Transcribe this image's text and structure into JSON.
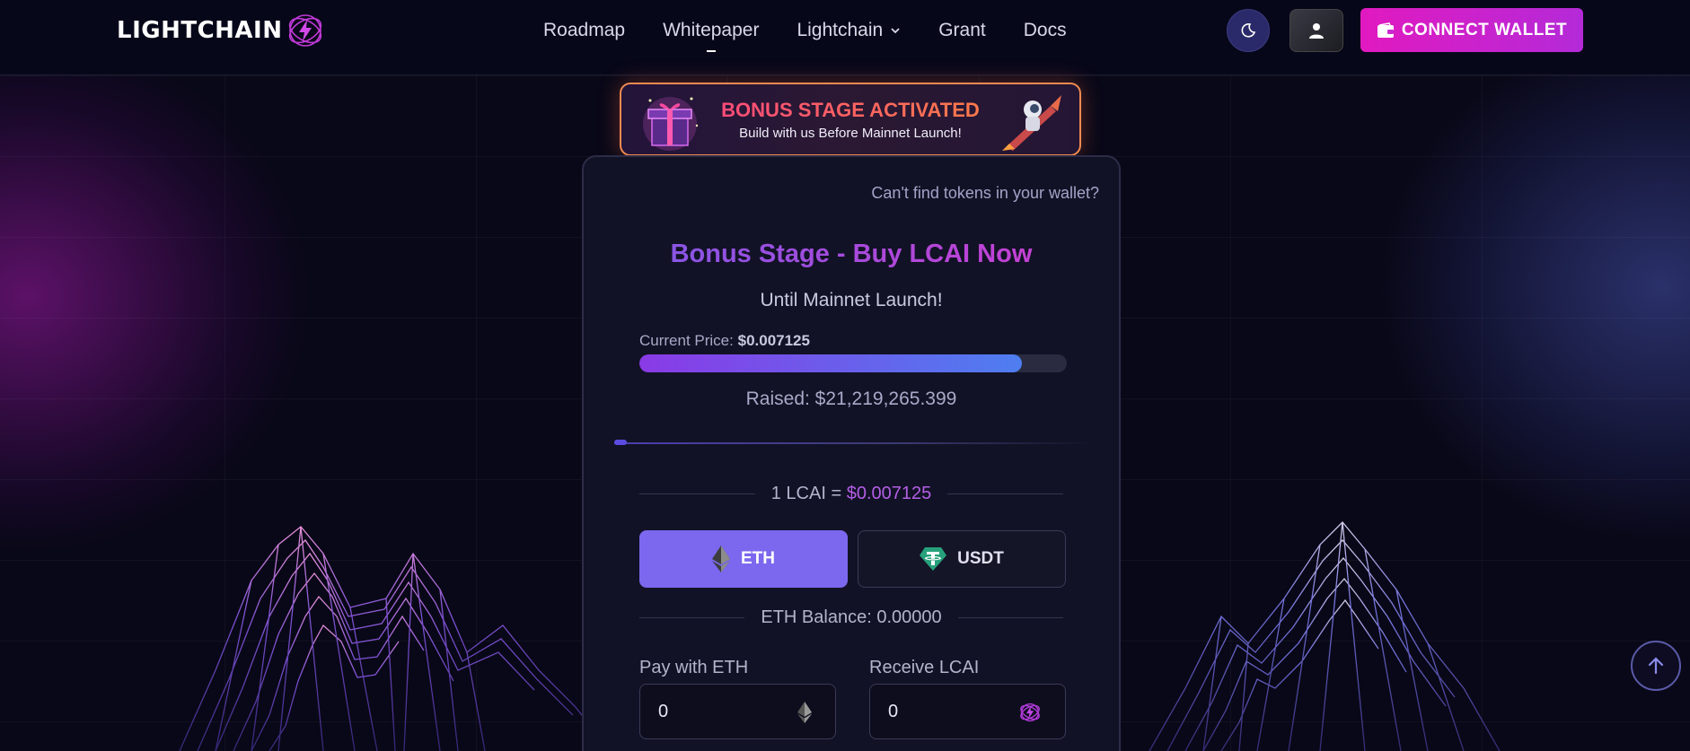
{
  "header": {
    "logo_text": "LIGHTCHAIN",
    "nav": [
      {
        "label": "Roadmap"
      },
      {
        "label": "Whitepaper"
      },
      {
        "label": "Lightchain"
      },
      {
        "label": "Grant"
      },
      {
        "label": "Docs"
      }
    ],
    "connect_wallet_label": "CONNECT WALLET"
  },
  "banner": {
    "title": "BONUS STAGE ACTIVATED",
    "subtitle": "Build with us Before Mainnet Launch!"
  },
  "card": {
    "help_link": "Can't find tokens in your wallet?",
    "title": "Bonus Stage - Buy LCAI Now",
    "subtitle": "Until Mainnet Launch!",
    "price_label": "Current Price:",
    "price_value": "$0.007125",
    "progress_fraction": 0.894,
    "raised": "Raised: $21,219,265.399",
    "rate_label": "1 LCAI =",
    "rate_value": "$0.007125",
    "tokens": [
      {
        "label": "ETH",
        "icon": "eth-icon"
      },
      {
        "label": "USDT",
        "icon": "usdt-icon"
      }
    ],
    "balance": "ETH Balance: 0.00000",
    "pay_label": "Pay with ETH",
    "pay_value": "0",
    "receive_label": "Receive LCAI",
    "receive_value": "0"
  },
  "colors": {
    "accent": "#e11ac0",
    "purple": "#7b68ee",
    "banner_border": "#f08a50"
  }
}
